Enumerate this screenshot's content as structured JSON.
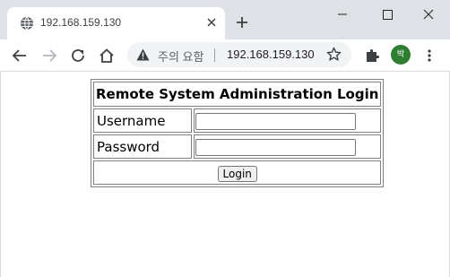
{
  "browser": {
    "tab_title": "192.168.159.130",
    "omnibox": {
      "security_label": "주의 요함",
      "url": "192.168.159.130"
    },
    "profile_initial": "박",
    "profile_color": "#2e7d32"
  },
  "login": {
    "title": "Remote System Administration Login",
    "username_label": "Username",
    "username_value": "",
    "password_label": "Password",
    "password_value": "",
    "submit_label": "Login"
  },
  "icons": {
    "favicon": "globe-icon",
    "tab_close": "close-icon",
    "new_tab": "plus-icon",
    "minimize": "minimize-icon",
    "maximize": "maximize-icon",
    "close_window": "close-icon",
    "back": "back-arrow-icon",
    "forward": "forward-arrow-icon",
    "reload": "reload-icon",
    "home": "home-icon",
    "not_secure": "warning-triangle-icon",
    "bookmark": "star-icon",
    "extensions": "puzzle-icon",
    "menu": "kebab-menu-icon"
  }
}
